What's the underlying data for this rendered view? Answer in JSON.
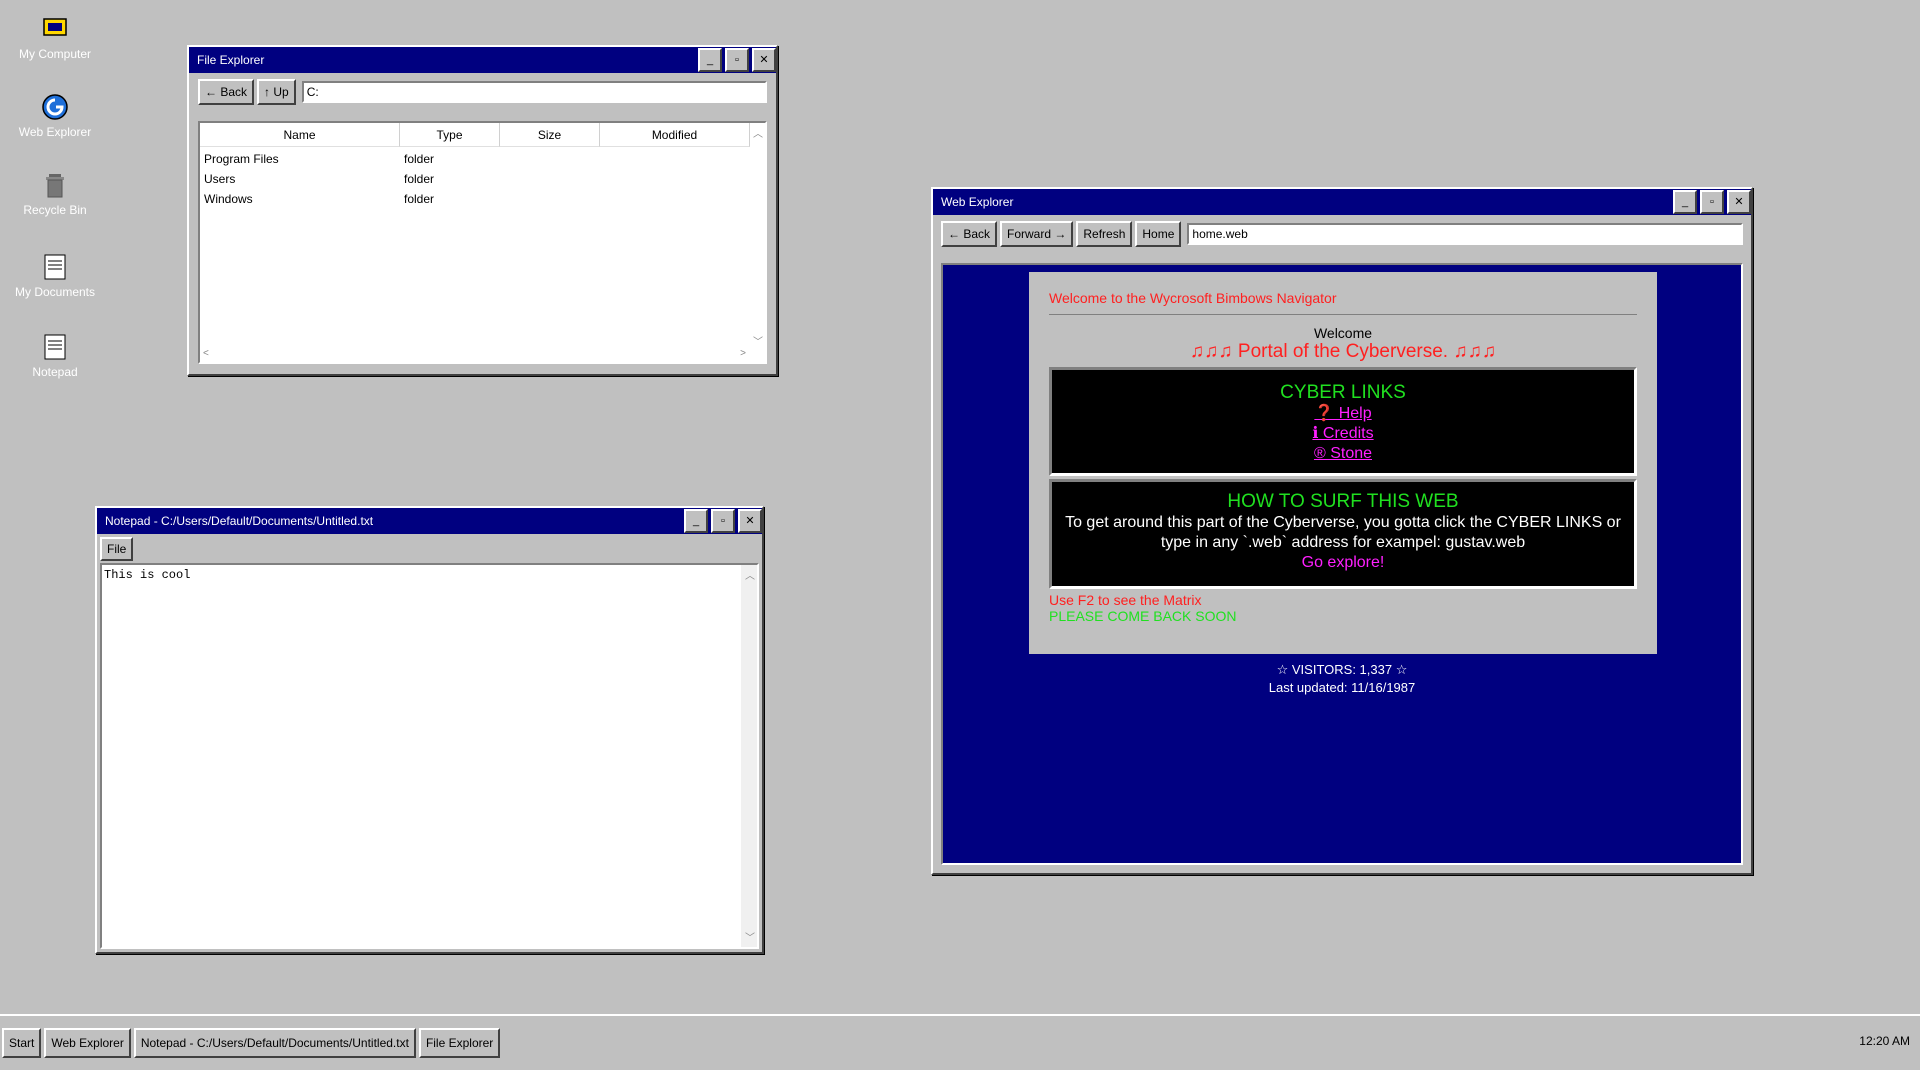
{
  "desktop": {
    "icons": [
      {
        "label": "My Computer",
        "icon": "computer-icon"
      },
      {
        "label": "Web Explorer",
        "icon": "web-explorer-icon"
      },
      {
        "label": "Recycle Bin",
        "icon": "recycle-bin-icon"
      },
      {
        "label": "My Documents",
        "icon": "document-icon"
      },
      {
        "label": "Notepad",
        "icon": "notepad-icon"
      }
    ]
  },
  "file_explorer": {
    "title": "File Explorer",
    "back_label": "← Back",
    "up_label": "↑ Up",
    "path": "C:",
    "columns": [
      "Name",
      "Type",
      "Size",
      "Modified"
    ],
    "rows": [
      {
        "name": "Program Files",
        "type": "folder",
        "size": "",
        "modified": ""
      },
      {
        "name": "Users",
        "type": "folder",
        "size": "",
        "modified": ""
      },
      {
        "name": "Windows",
        "type": "folder",
        "size": "",
        "modified": ""
      }
    ]
  },
  "notepad": {
    "title": "Notepad - C:/Users/Default/Documents/Untitled.txt",
    "menu_file": "File",
    "content": "This is cool"
  },
  "web_explorer": {
    "title": "Web Explorer",
    "back_label": "← Back",
    "forward_label": "Forward →",
    "refresh_label": "Refresh",
    "home_label": "Home",
    "address": "home.web",
    "page": {
      "heading": "Welcome to the Wycrosoft Bimbows Navigator",
      "welcome": "Welcome",
      "portal": "♫♫♫ Portal of the Cyberverse. ♫♫♫",
      "links_title": "CYBER LINKS",
      "links": [
        "❓ Help",
        "ℹ Credits",
        "® Stone"
      ],
      "surf_title": "HOW TO SURF THIS WEB",
      "surf_text": "To get around this part of the Cyberverse, you gotta click the CYBER LINKS or type in any `.web` address for exampel: gustav.web",
      "surf_cta": "Go explore!",
      "matrix_hint": "Use F2 to see the Matrix",
      "come_back": "PLEASE COME BACK SOON",
      "visitors": "☆ VISITORS: 1,337 ☆",
      "updated": "Last updated: 11/16/1987"
    }
  },
  "taskbar": {
    "start_label": "Start",
    "items": [
      "Web Explorer",
      "Notepad - C:/Users/Default/Documents/Untitled.txt",
      "File Explorer"
    ],
    "clock": "12:20 AM"
  },
  "colors": {
    "desktop": "#c0c0c0",
    "titlebar": "#000080",
    "web_background": "#000080",
    "link": "#ff20ff",
    "green_text": "#20e020",
    "red_text": "#ff2020"
  }
}
